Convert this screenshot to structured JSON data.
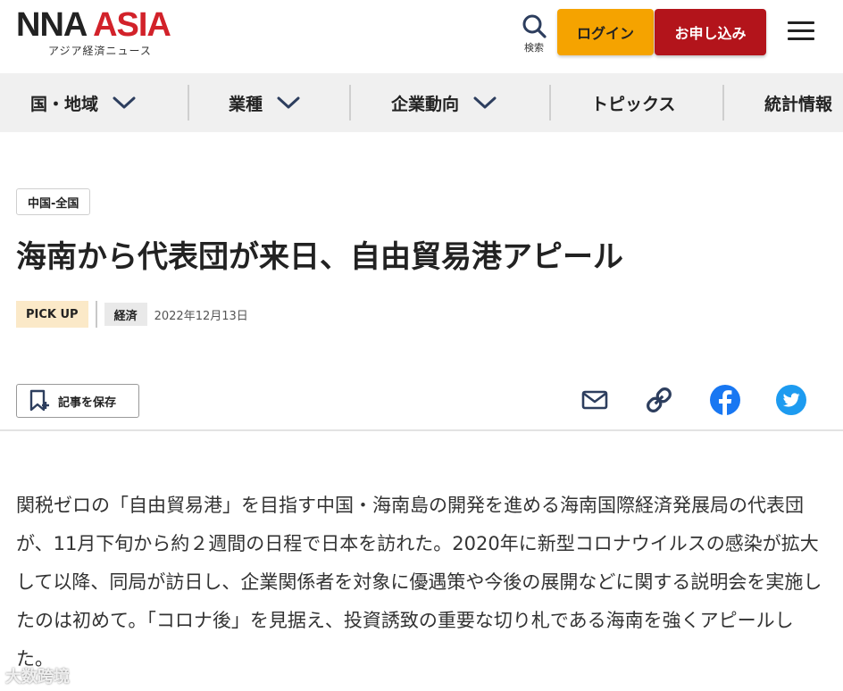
{
  "header": {
    "logo_nna": "NNA",
    "logo_asia": "ASIA",
    "logo_sub": "アジア経済ニュース",
    "search_label": "検索",
    "login_label": "ログイン",
    "signup_label": "お申し込み"
  },
  "nav": {
    "items": [
      {
        "label": "国・地域",
        "dropdown": true
      },
      {
        "label": "業種",
        "dropdown": true
      },
      {
        "label": "企業動向",
        "dropdown": true
      },
      {
        "label": "トピックス",
        "dropdown": false
      },
      {
        "label": "統計情報",
        "dropdown": false
      }
    ]
  },
  "article": {
    "region_tag": "中国-全国",
    "title": "海南から代表団が来日、自由貿易港アピール",
    "pickup_badge": "PICK UP",
    "category": "経済",
    "date": "2022年12月13日",
    "save_label": "記事を保存",
    "share_icons": [
      "mail-icon",
      "link-icon",
      "facebook-icon",
      "twitter-icon"
    ],
    "body": "関税ゼロの「自由貿易港」を目指す中国・海南島の開発を進める海南国際経済発展局の代表団が、11月下旬から約２週間の日程で日本を訪れた。2020年に新型コロナウイルスの感染が拡大して以降、同局が訪日し、企業関係者を対象に優遇策や今後の展開などに関する説明会を実施したのは初めて。「コロナ後」を見据え、投資誘致の重要な切り札である海南を強くアピールした。"
  },
  "watermark": "大数跨境",
  "colors": {
    "asia_red": "#d2222a",
    "login_orange": "#f5a300",
    "signup_red": "#b3141b",
    "pickup_bg": "#fbe9c8",
    "facebook_blue": "#1877f2",
    "twitter_blue": "#1d9bf0",
    "icon_navy": "#2d3e5e"
  }
}
